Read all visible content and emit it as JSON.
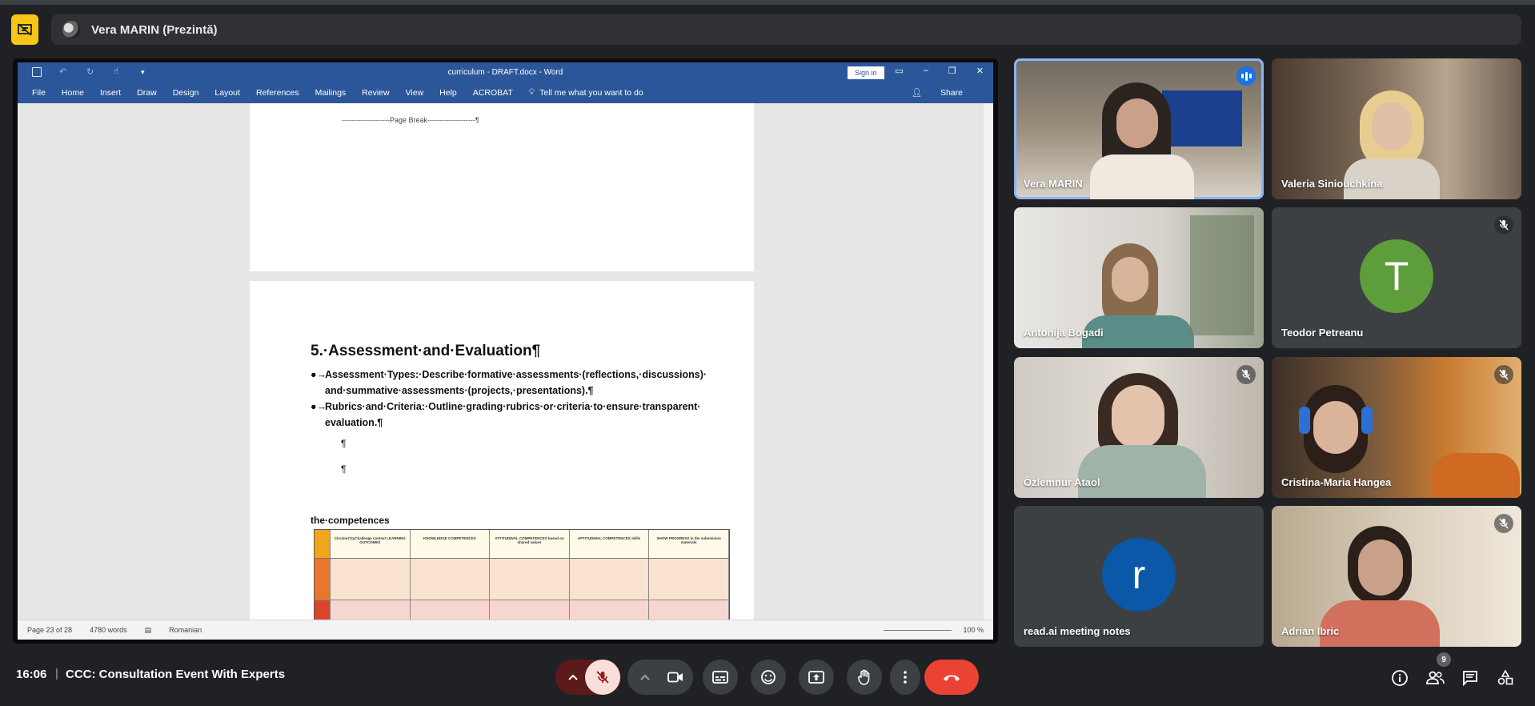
{
  "presenter": {
    "label": "Vera MARIN (Prezintă)"
  },
  "word": {
    "doc_title": "curriculum - DRAFT.docx - Word",
    "sign_in": "Sign in",
    "share": "Share",
    "menu": [
      "File",
      "Home",
      "Insert",
      "Draw",
      "Design",
      "Layout",
      "References",
      "Mailings",
      "Review",
      "View",
      "Help",
      "ACROBAT"
    ],
    "tell_me": "Tell me what you want to do",
    "page_break": "--------------------Page Break--------------------¶",
    "section_title": "5.·Assessment·and·Evaluation¶",
    "bullets": [
      {
        "line1": "Assessment·Types:·Describe·formative·assessments·(reflections,·discussions)·",
        "line2": "and·summative·assessments·(projects,·presentations).¶"
      },
      {
        "line1": "Rubrics·and·Criteria:·Outline·grading·rubrics·or·criteria·to·ensure·transparent·",
        "line2": "evaluation.¶"
      }
    ],
    "pilcrow": "¶",
    "bullet_mark": "●→",
    "competences_label": "the·competences",
    "table_headers": [
      "CircularCityChallenge context LEARNING OUTCOMES",
      "KNOWLEDGE COMPETENCES",
      "ATTITUDINAL COMPETENCES based on shared values",
      "APTITUDINAL COMPETENCES skills",
      "SHOW PROGRESS in the submission materials"
    ],
    "status": {
      "page": "Page 23 of 28",
      "words": "4780 words",
      "language": "Romanian",
      "zoom": "100 %"
    }
  },
  "participants": [
    {
      "name": "Vera MARIN",
      "muted": false,
      "speaking": true
    },
    {
      "name": "Valeria Siniouchkina",
      "muted": false
    },
    {
      "name": "Antonija Bogadi",
      "muted": false
    },
    {
      "name": "Teodor Petreanu",
      "muted": true,
      "initial": "T",
      "avatar_color": "#5e9e3a"
    },
    {
      "name": "Özlemnur Ataol",
      "muted": true
    },
    {
      "name": "Cristina-Maria Hangea",
      "muted": true
    },
    {
      "name": "read.ai meeting notes",
      "muted": false,
      "initial": "r",
      "avatar_color": "#0b57a8"
    },
    {
      "name": "Adrian Ibric",
      "muted": true
    }
  ],
  "bottom": {
    "time": "16:06",
    "separator": "|",
    "meeting_title": "CCC: Consultation Event With Experts",
    "people_count": "9"
  }
}
